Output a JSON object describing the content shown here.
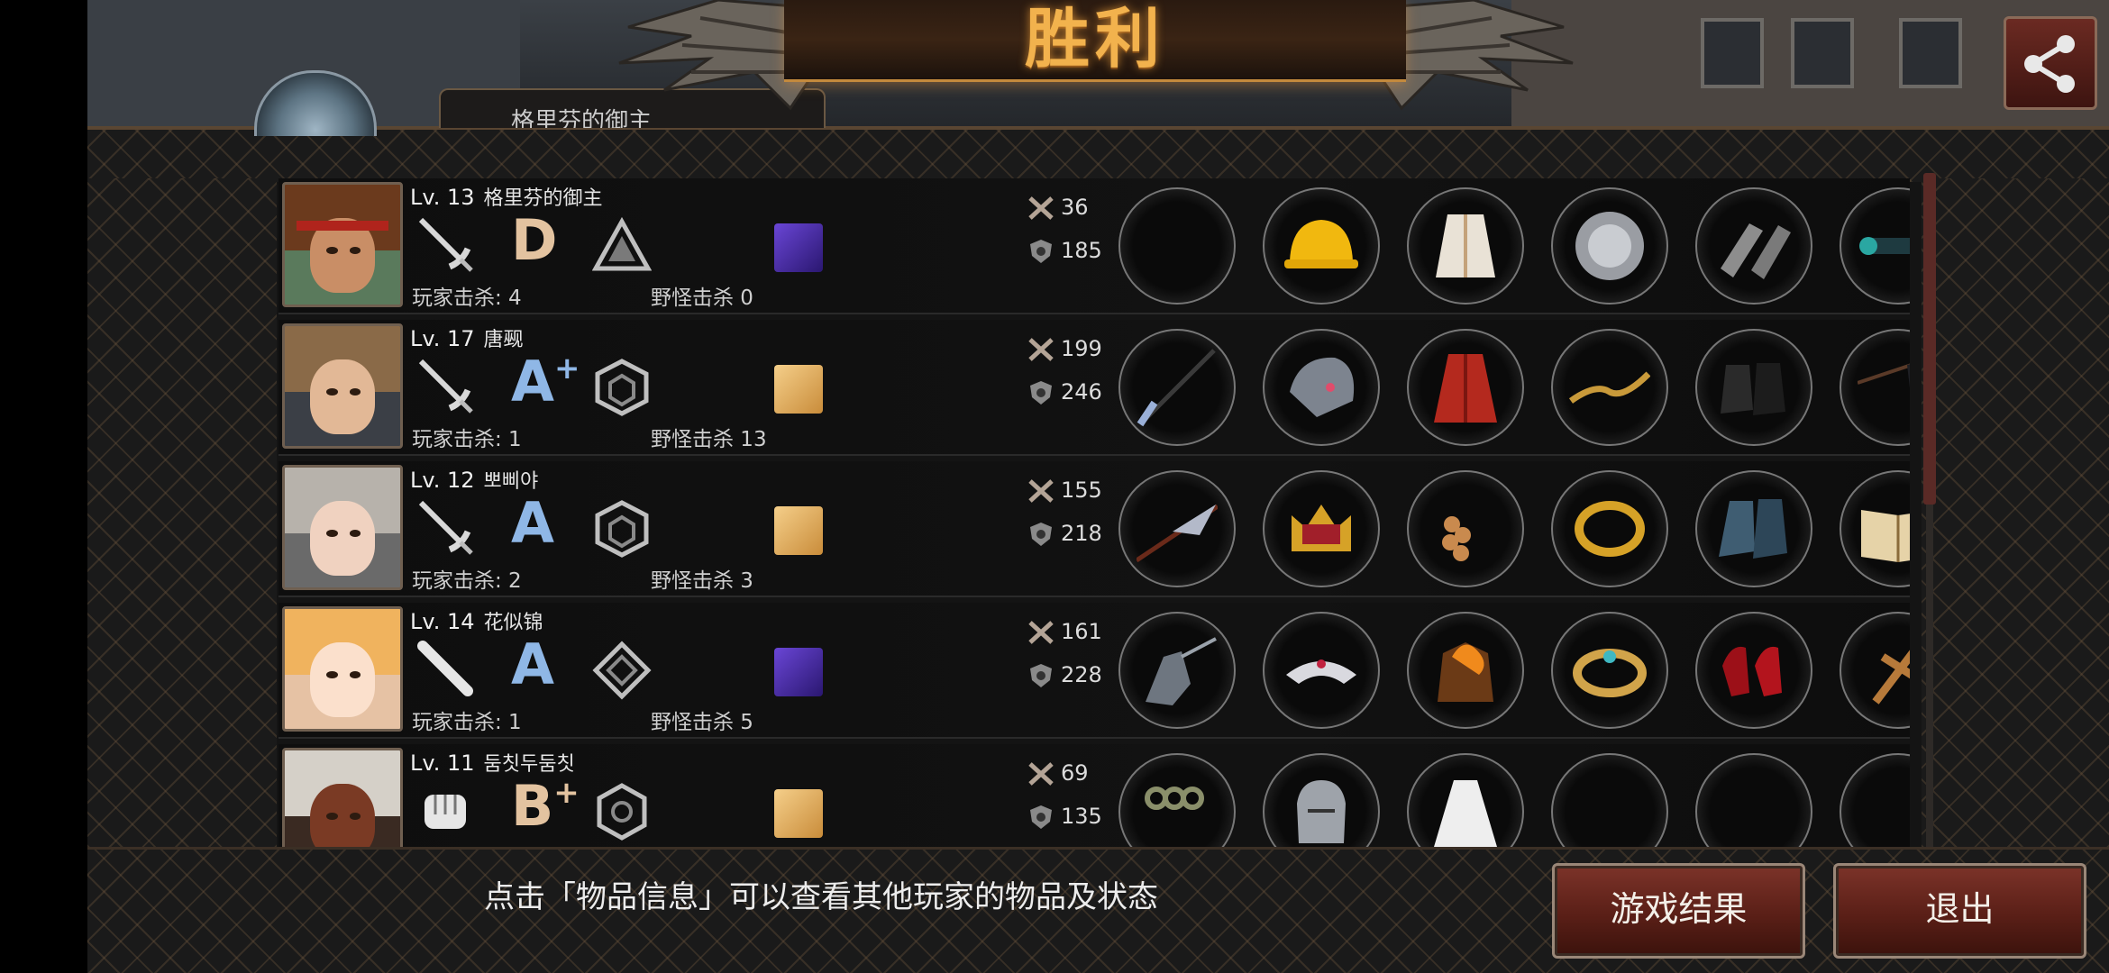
{
  "header": {
    "title": "胜利",
    "top_tab_label": "格里芬的御主"
  },
  "players": [
    {
      "level": "Lv. 13",
      "name": "格里芬的御主",
      "grade": "D",
      "grade_plus": "",
      "player_kills_label": "玩家击杀: 4",
      "monster_kills_label": "野怪击杀 0",
      "attack": "36",
      "defense": "185",
      "weapon_icon": "sword-icon",
      "trait_icon": "triangle-trait-icon",
      "tile_color": "#4b2f9e",
      "items": [
        "empty-slot",
        "hard-hat-icon",
        "white-robe-icon",
        "metal-disc-icon",
        "chain-gauntlets-icon",
        "scope-icon"
      ]
    },
    {
      "level": "Lv. 17",
      "name": "唐觋",
      "grade": "A",
      "grade_plus": "+",
      "player_kills_label": "玩家击杀: 1",
      "monster_kills_label": "野怪击杀 13",
      "attack": "199",
      "defense": "246",
      "weapon_icon": "sword-icon",
      "trait_icon": "cube-trait-icon",
      "tile_color": "#e7b15c",
      "items": [
        "spear-icon",
        "armored-helmet-icon",
        "red-coat-icon",
        "golden-snake-staff-icon",
        "combat-boots-icon",
        "flag-spear-icon"
      ]
    },
    {
      "level": "Lv. 12",
      "name": "뽀삐야",
      "grade": "A",
      "grade_plus": "",
      "player_kills_label": "玩家击杀: 2",
      "monster_kills_label": "野怪击杀 3",
      "attack": "155",
      "defense": "218",
      "weapon_icon": "sword-icon",
      "trait_icon": "cube-trait-icon",
      "tile_color": "#e7b15c",
      "items": [
        "lance-icon",
        "crown-icon",
        "grapes-ornament-icon",
        "gold-bracelet-icon",
        "steel-boots-icon",
        "open-book-icon"
      ]
    },
    {
      "level": "Lv. 14",
      "name": "花似锦",
      "grade": "A",
      "grade_plus": "",
      "player_kills_label": "玩家击杀: 1",
      "monster_kills_label": "野怪击杀 5",
      "attack": "161",
      "defense": "228",
      "weapon_icon": "bat-icon",
      "trait_icon": "diamond-trait-icon",
      "tile_color": "#4b2f9e",
      "items": [
        "statue-icon",
        "tiara-icon",
        "flaming-armor-icon",
        "jeweled-band-icon",
        "red-heels-icon",
        "cross-icon"
      ]
    },
    {
      "level": "Lv. 11",
      "name": "둠칫두둠칫",
      "grade": "B",
      "grade_plus": "+",
      "player_kills_label": "",
      "monster_kills_label": "",
      "attack": "69",
      "defense": "135",
      "weapon_icon": "fist-icon",
      "trait_icon": "hexagon-trait-icon",
      "tile_color": "#e7b15c",
      "items": [
        "knuckles-icon",
        "knight-helmet-icon",
        "white-dress-icon",
        "empty-slot",
        "empty-slot",
        "empty-slot"
      ]
    }
  ],
  "footer": {
    "hint": "点击「物品信息」可以查看其他玩家的物品及状态",
    "result_button": "游戏结果",
    "exit_button": "退出"
  },
  "colors": {
    "title_gold": "#f2b24d",
    "button_red": "#5a1f17",
    "grade_blue": "#8fb7e6",
    "grade_tan": "#e3c3a0"
  }
}
